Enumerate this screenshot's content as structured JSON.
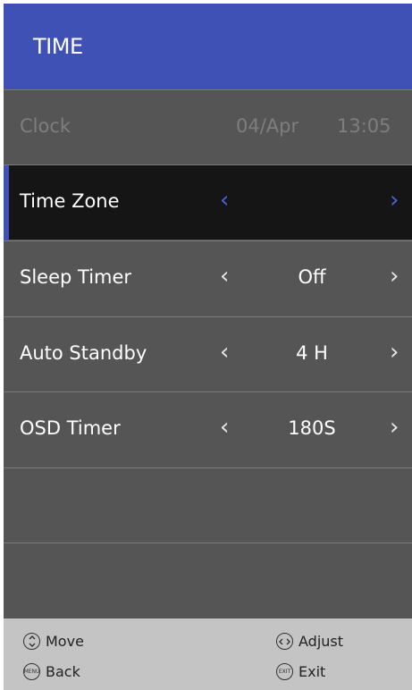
{
  "header": {
    "title": "TIME"
  },
  "menu": {
    "clock": {
      "label": "Clock",
      "date": "04/Apr",
      "time": "13:05"
    },
    "items": [
      {
        "label": "Time Zone",
        "value": ""
      },
      {
        "label": "Sleep Timer",
        "value": "Off"
      },
      {
        "label": "Auto Standby",
        "value": "4 H"
      },
      {
        "label": "OSD Timer",
        "value": "180S"
      }
    ]
  },
  "footer": {
    "move": "Move",
    "adjust": "Adjust",
    "back": "Back",
    "exit": "Exit",
    "menu_icon_text": "MENU",
    "exit_icon_text": "EXIT"
  },
  "colors": {
    "header": "#3f51b5",
    "selected_arrow": "#4a63d8",
    "panel": "#555555"
  }
}
